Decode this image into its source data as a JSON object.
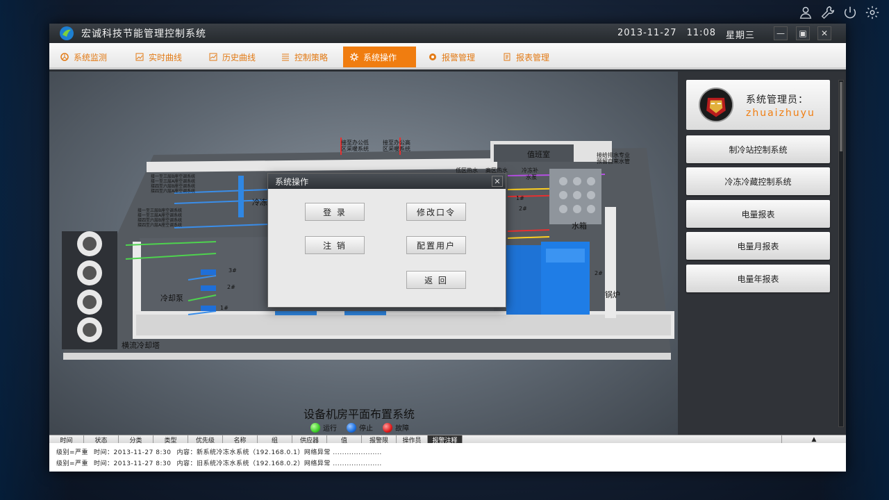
{
  "app": {
    "title": "宏诚科技节能管理控制系统",
    "date": "2013-11-27",
    "time": "11:08",
    "weekday": "星期三"
  },
  "nav": [
    {
      "label": "系统监测",
      "icon": "monitor-icon"
    },
    {
      "label": "实时曲线",
      "icon": "chart-icon"
    },
    {
      "label": "历史曲线",
      "icon": "history-chart-icon"
    },
    {
      "label": "控制策略",
      "icon": "list-icon"
    },
    {
      "label": "系统操作",
      "icon": "gear-icon",
      "active": true
    },
    {
      "label": "报警管理",
      "icon": "alarm-icon"
    },
    {
      "label": "报表管理",
      "icon": "report-icon"
    }
  ],
  "sidebar": {
    "user_role": "系统管理员：",
    "user_name": "zhuaizhuyu",
    "buttons": [
      "制冷站控制系统",
      "冷冻冷藏控制系统",
      "电量报表",
      "电量月报表",
      "电量年报表"
    ]
  },
  "dialog": {
    "title": "系统操作",
    "login": "登  录",
    "change_password": "修改口令",
    "logout": "注  销",
    "config_users": "配置用户",
    "back": "返  回"
  },
  "scene": {
    "caption": "设备机房平面布置系统",
    "legend": [
      {
        "label": "运行",
        "color": "#3fcf2a"
      },
      {
        "label": "停止",
        "color": "#1b6fe0"
      },
      {
        "label": "故障",
        "color": "#e01b1b"
      }
    ],
    "labels": {
      "duty_room": "值班室",
      "water_tank": "水箱",
      "boiler": "锅炉",
      "cooling_pump": "冷却泵",
      "cooling_tower": "横流冷却塔",
      "chiller_partial": "冷冻",
      "low_zone_hot": "低区热水",
      "high_zone_hot": "高区热水",
      "cold_supply": "冷冻补",
      "pump": "水泵",
      "pump3": "3#",
      "pump2": "2#",
      "pump1": "1#",
      "boiler1": "1#",
      "boiler2": "2#",
      "boiler2b": "2#",
      "note_office_low": "接至办公低\n区采暖系统",
      "note_office_high": "接至办公高\n区采暖系统",
      "note_drain": "接给排水专业\n预留自来水管",
      "note_ac_a": "接一至三层B座空调系统\n接一至三层A座空调系统\n接四至六层B座空调系统\n接四至六层A座空调系统",
      "note_ac_b": "接一至三层B座空调系统\n接一至三层A座空调系统\n接四至六层B座空调系统\n接四至六层A座空调系统"
    }
  },
  "grid": {
    "columns": [
      "时间",
      "状态",
      "分类",
      "类型",
      "优先级",
      "名称",
      "组",
      "供应器",
      "值",
      "报警限",
      "操作员",
      "报警注释"
    ],
    "rows": [
      {
        "level": "级别=严重",
        "time": "时间：2013-11-27   8:30",
        "content": "内容：新系统冷冻水系统（192.168.0.1）网络异常 ....................."
      },
      {
        "level": "级别=严重",
        "time": "时间：2013-11-27   8:30",
        "content": "内容：旧系统冷冻水系统（192.168.0.2）网络异常 ....................."
      }
    ]
  }
}
